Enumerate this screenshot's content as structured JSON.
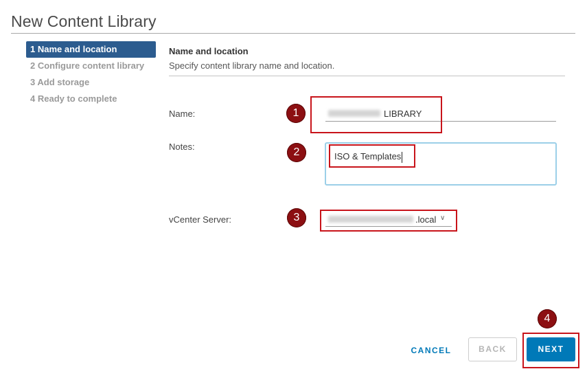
{
  "window": {
    "title": "New Content Library"
  },
  "steps": [
    {
      "label": "1 Name and location",
      "active": true
    },
    {
      "label": "2 Configure content library",
      "active": false
    },
    {
      "label": "3 Add storage",
      "active": false
    },
    {
      "label": "4 Ready to complete",
      "active": false
    }
  ],
  "section": {
    "title": "Name and location",
    "description": "Specify content library name and location."
  },
  "form": {
    "name_label": "Name:",
    "name_value_visible": "LIBRARY",
    "notes_label": "Notes:",
    "notes_value": "ISO & Templates",
    "vcenter_label": "vCenter Server:",
    "vcenter_value_visible": ".local"
  },
  "annotations": {
    "badges": [
      "1",
      "2",
      "3",
      "4"
    ],
    "color": "#c8131a",
    "badge_color": "#8c0f12"
  },
  "buttons": {
    "cancel": "CANCEL",
    "back": "BACK",
    "next": "NEXT"
  },
  "colors": {
    "accent": "#0079b8",
    "active_step": "#2c5c8f",
    "notes_focus": "#9bcfe8"
  }
}
